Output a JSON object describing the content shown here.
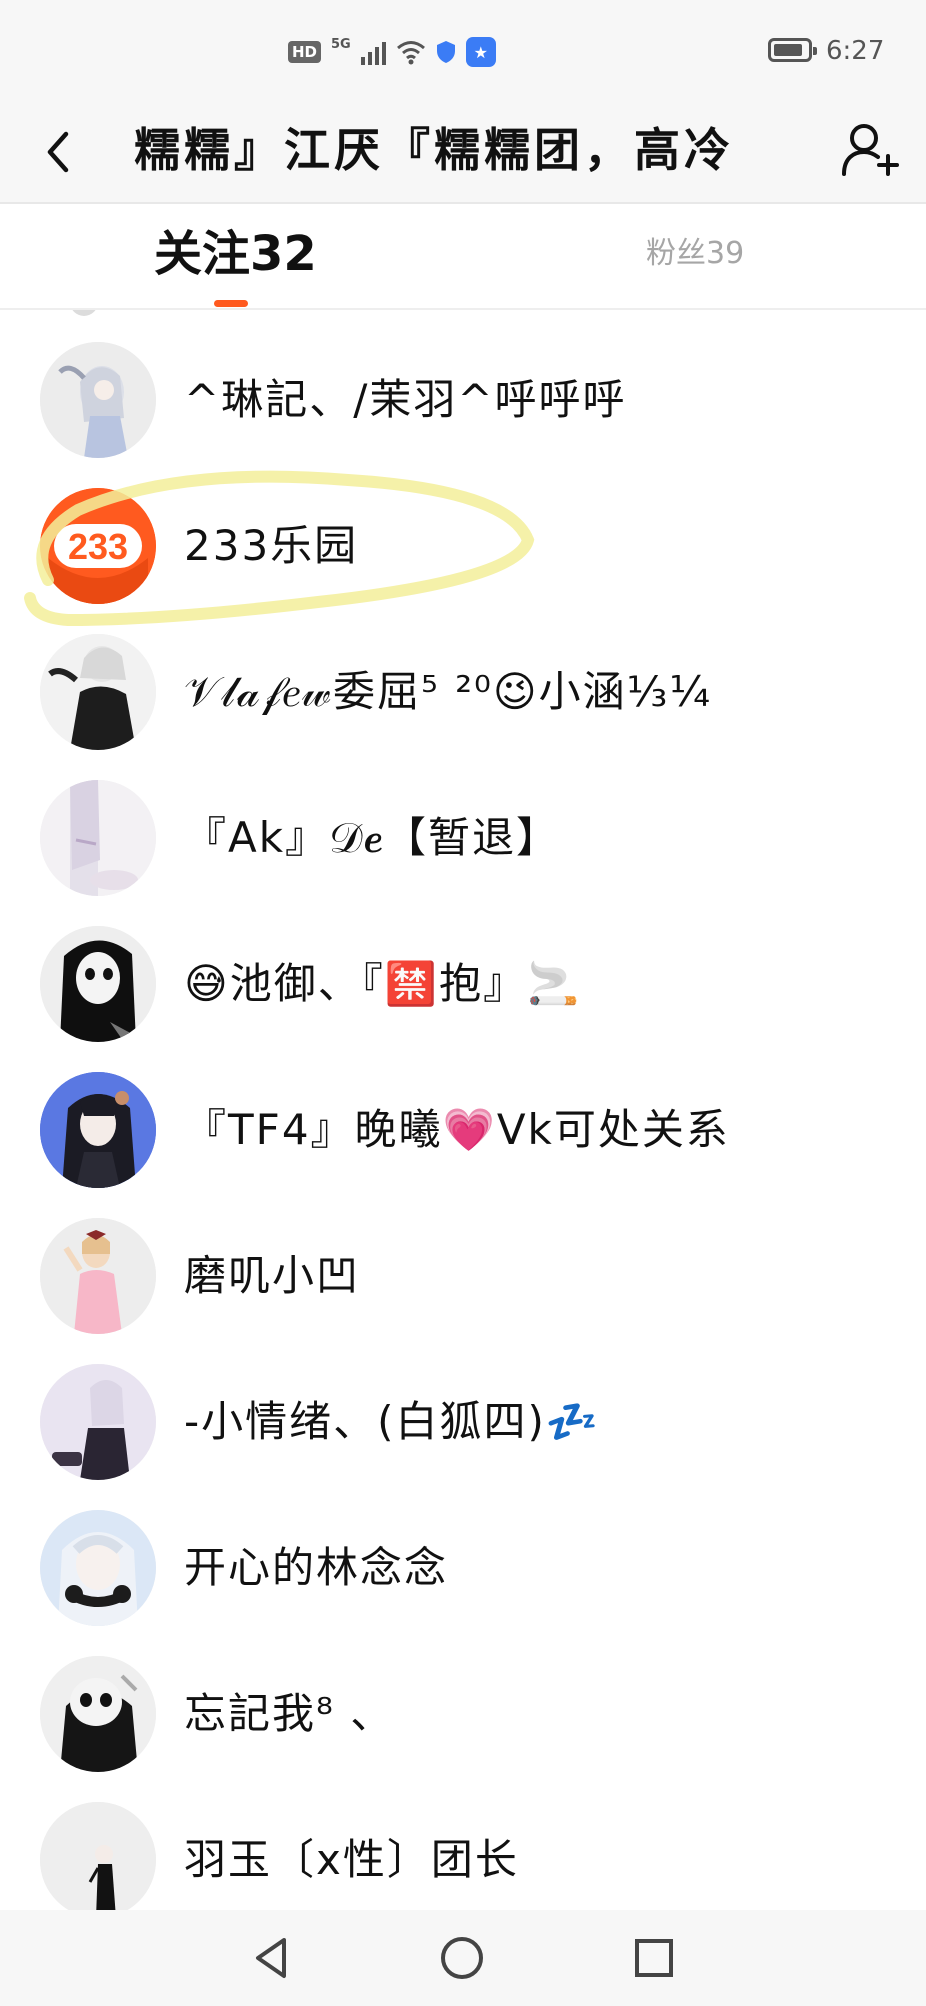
{
  "status_bar": {
    "hd": "HD",
    "network": "5G",
    "app_badge": "★",
    "time": "6:27"
  },
  "header": {
    "title": "糯糯』江厌『糯糯团，高冷",
    "icons": [
      "back-icon",
      "add-user-icon"
    ]
  },
  "tabs": [
    {
      "label": "关注32",
      "active": true
    },
    {
      "label": "粉丝39",
      "active": false
    }
  ],
  "accent_color": "#ff5a1f",
  "highlight_color": "#f3ef9a",
  "following": [
    {
      "name": "^琳記、/茉羽^呼呼呼",
      "avatar": "anime-white-hair"
    },
    {
      "name": "233乐园",
      "avatar": "233-logo",
      "avatar_text": "233",
      "highlighted": true
    },
    {
      "name": "𝒱𝓁𝒶𝒻𝑒𝓌委屈⁵ ²⁰😉小涵⅓¼",
      "avatar": "anime-black-dress"
    },
    {
      "name": "『Ak』𝒟𝒆【暂退】",
      "avatar": "anime-pale"
    },
    {
      "name": "😅池御、『🈲抱』🚬",
      "avatar": "anime-dark-mono"
    },
    {
      "name": "『TF4』晚曦💗Vk可处关系",
      "avatar": "anime-blue-bg"
    },
    {
      "name": "磨叽小凹",
      "avatar": "anime-pink-dress"
    },
    {
      "name": "-小情绪、(白狐四)💤",
      "avatar": "anime-purple"
    },
    {
      "name": "开心的林念念",
      "avatar": "anime-headphones"
    },
    {
      "name": "忘記我⁸ 、",
      "avatar": "anime-mask"
    },
    {
      "name": "羽玉〔x性〕团长",
      "avatar": "anime-small-figure"
    }
  ],
  "system_nav": [
    "back-triangle-icon",
    "home-circle-icon",
    "recents-square-icon"
  ]
}
